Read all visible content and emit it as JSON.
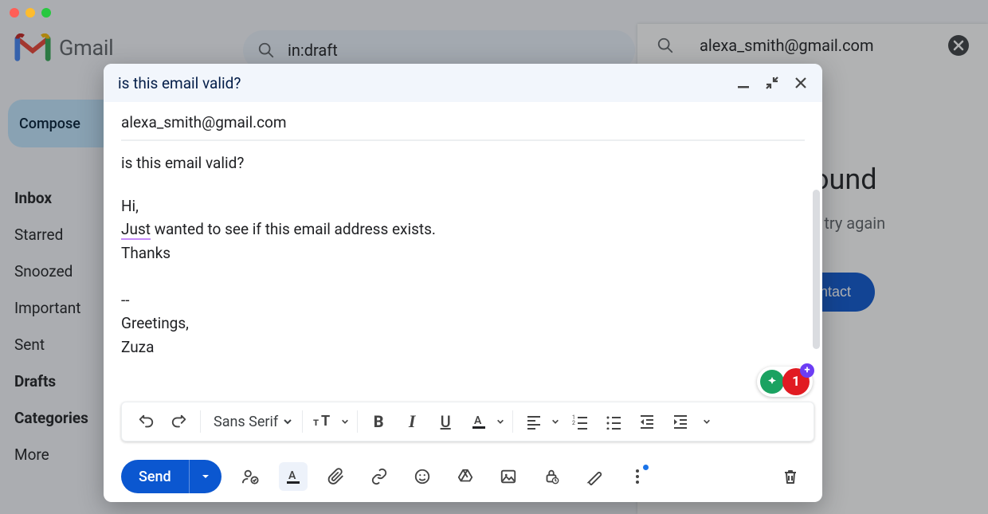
{
  "app": {
    "name": "Gmail"
  },
  "search": {
    "icon": "search-icon",
    "query": "in:draft"
  },
  "side_panel": {
    "email": "alexa_smith@gmail.com",
    "results_headline_fragment": "s found",
    "subline_fragment": "g and try again",
    "create_button_fragment": "contact"
  },
  "sidebar": {
    "compose": "Compose",
    "items": [
      {
        "label": "Inbox",
        "bold": true
      },
      {
        "label": "Starred"
      },
      {
        "label": "Snoozed"
      },
      {
        "label": "Important"
      },
      {
        "label": "Sent"
      },
      {
        "label": "Drafts",
        "bold": true
      },
      {
        "label": "Categories",
        "bold": true
      },
      {
        "label": "More"
      }
    ]
  },
  "compose": {
    "title": "is this email valid?",
    "to": "alexa_smith@gmail.com",
    "subject": "is this email valid?",
    "body_lines": {
      "l0": "Hi,",
      "l1a": "Just",
      "l1b": " wanted to see if this email address exists.",
      "l2": "Thanks",
      "l3": "",
      "l4": "--",
      "l5": "Greetings,",
      "l6": "Zuza"
    },
    "format": {
      "font": "Sans Serif"
    },
    "send": "Send",
    "grammar_badge": "1"
  }
}
